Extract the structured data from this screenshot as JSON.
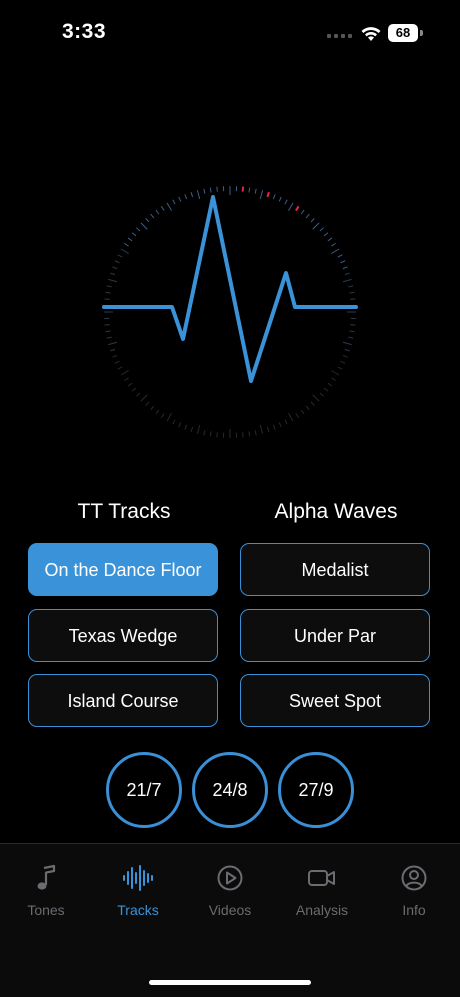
{
  "status": {
    "time": "3:33",
    "battery": "68"
  },
  "sections": {
    "left_title": "TT Tracks",
    "right_title": "Alpha Waves"
  },
  "tt_tracks": [
    "On the Dance Floor",
    "Texas Wedge",
    "Island Course"
  ],
  "alpha_waves": [
    "Medalist",
    "Under Par",
    "Sweet Spot"
  ],
  "ratios": [
    "21/7",
    "24/8",
    "27/9"
  ],
  "active_track": "On the Dance Floor",
  "tabs": [
    {
      "label": "Tones",
      "icon": "music-note-icon"
    },
    {
      "label": "Tracks",
      "icon": "waveform-icon"
    },
    {
      "label": "Videos",
      "icon": "play-circle-icon"
    },
    {
      "label": "Analysis",
      "icon": "video-camera-icon"
    },
    {
      "label": "Info",
      "icon": "person-circle-icon"
    }
  ],
  "active_tab": "Tracks",
  "colors": {
    "accent": "#3a93d9",
    "tick_highlight": "#e0284a",
    "background": "#000000"
  }
}
